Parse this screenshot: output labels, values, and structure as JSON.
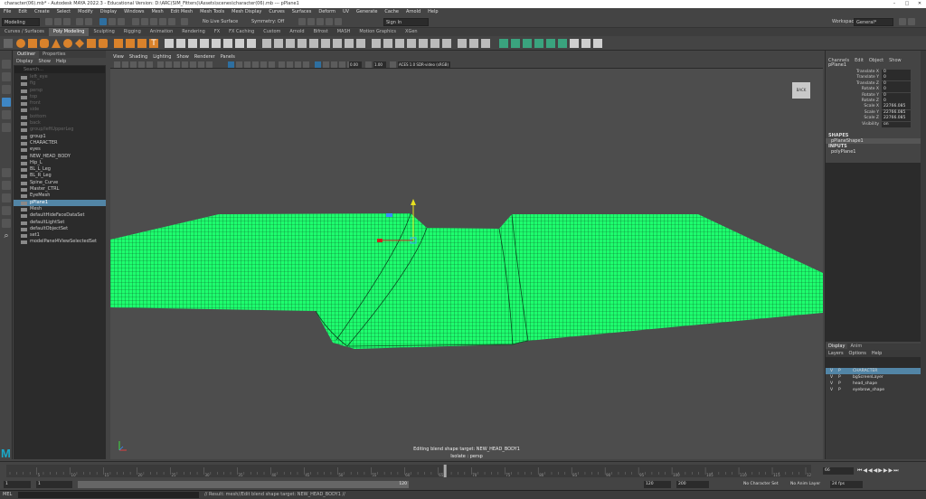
{
  "window": {
    "title": "character(06).mb* - Autodesk MAYA 2022.3 - Educational Version: D:\\ARC(SIM_Fitters)\\Assets\\scenes\\character(06).mb --- pPlane1"
  },
  "menubar": [
    "File",
    "Edit",
    "Create",
    "Select",
    "Modify",
    "Display",
    "Windows",
    "Mesh",
    "Edit Mesh",
    "Mesh Tools",
    "Mesh Display",
    "Curves",
    "Surfaces",
    "Deform",
    "UV",
    "Generate",
    "Cache",
    "Arnold",
    "Help"
  ],
  "status": {
    "mode": "Modeling",
    "live_surface": "No Live Surface",
    "symmetry": "Symmetry: Off",
    "sign_in": "Sign In",
    "workspace_label": "Workspace:",
    "workspace": "General*"
  },
  "shelf_tabs": [
    "Curves / Surfaces",
    "Poly Modeling",
    "Sculpting",
    "Rigging",
    "Animation",
    "Rendering",
    "FX",
    "FX Caching",
    "Custom",
    "Arnold",
    "Bifrost",
    "MASH",
    "Motion Graphics",
    "XGen"
  ],
  "shelf_active": "Poly Modeling",
  "outliner": {
    "tabs": [
      "Outliner",
      "Properties"
    ],
    "menu": [
      "Display",
      "Show",
      "Help"
    ],
    "search": "Search...",
    "items": [
      {
        "label": "left_eye",
        "dim": true
      },
      {
        "label": "fig",
        "dim": true
      },
      {
        "label": "persp",
        "dim": true
      },
      {
        "label": "top",
        "dim": true
      },
      {
        "label": "front",
        "dim": true
      },
      {
        "label": "side",
        "dim": true
      },
      {
        "label": "bottom",
        "dim": true
      },
      {
        "label": "back",
        "dim": true
      },
      {
        "label": "group/leftUpperLeg",
        "dim": true
      },
      {
        "label": "group1",
        "dim": false
      },
      {
        "label": "CHARACTER",
        "dim": false
      },
      {
        "label": "eyes",
        "dim": false
      },
      {
        "label": "NEW_HEAD_BODY",
        "dim": false
      },
      {
        "label": "Hip_L",
        "dim": false
      },
      {
        "label": "BL_L_Leg",
        "dim": false
      },
      {
        "label": "BL_R_Leg",
        "dim": false
      },
      {
        "label": "Spine_Curve",
        "dim": false
      },
      {
        "label": "Master_CTRL",
        "dim": false
      },
      {
        "label": "EyeMesh",
        "dim": false
      },
      {
        "label": "pPlane1",
        "dim": false,
        "selected": true
      },
      {
        "label": "Mesh",
        "dim": false
      },
      {
        "label": "defaultHideFaceDataSet",
        "dim": false
      },
      {
        "label": "defaultLightSet",
        "dim": false
      },
      {
        "label": "defaultObjectSet",
        "dim": false
      },
      {
        "label": "set1",
        "dim": false
      },
      {
        "label": "modelPanel4ViewSelectedSet",
        "dim": false
      }
    ]
  },
  "viewport": {
    "menu": [
      "View",
      "Shading",
      "Lighting",
      "Show",
      "Renderer",
      "Panels"
    ],
    "field1": "0.00",
    "field2": "1.00",
    "color_space": "ACES 1.0 SDR-video (sRGB)",
    "viewcube": "BACK",
    "caption1": "Editing blend shape target: NEW_HEAD_BODY1",
    "caption2": "Isolate : persp",
    "mesh_color": "#1eff6e"
  },
  "channelbox": {
    "menu": [
      "Channels",
      "Edit",
      "Object",
      "Show"
    ],
    "object": "pPlane1",
    "channels": [
      {
        "label": "Translate X",
        "value": "0"
      },
      {
        "label": "Translate Y",
        "value": "0"
      },
      {
        "label": "Translate Z",
        "value": "0"
      },
      {
        "label": "Rotate X",
        "value": "0"
      },
      {
        "label": "Rotate Y",
        "value": "0"
      },
      {
        "label": "Rotate Z",
        "value": "0"
      },
      {
        "label": "Scale X",
        "value": "22766.085"
      },
      {
        "label": "Scale Y",
        "value": "22766.085"
      },
      {
        "label": "Scale Z",
        "value": "22766.085"
      },
      {
        "label": "Visibility",
        "value": "on"
      }
    ],
    "shapes_label": "SHAPES",
    "shape": "pPlaneShape1",
    "inputs_label": "INPUTS",
    "input": "polyPlane1"
  },
  "layers": {
    "tabs": [
      "Display",
      "Anim"
    ],
    "menu": [
      "Layers",
      "Options",
      "Help"
    ],
    "items": [
      {
        "v": "V",
        "p": "P",
        "name": "CHARACTER",
        "selected": true
      },
      {
        "v": "V",
        "p": "P",
        "name": "bgScreenLayer"
      },
      {
        "v": "V",
        "p": "P",
        "name": "head_shape"
      },
      {
        "v": "V",
        "p": "P",
        "name": "eyebrow_shape"
      }
    ]
  },
  "timeline": {
    "current_frame": "66",
    "tick_labels": [
      "5",
      "10",
      "15",
      "20",
      "25",
      "30",
      "35",
      "40",
      "45",
      "50",
      "55",
      "60",
      "65",
      "70",
      "75",
      "80",
      "85",
      "90",
      "95",
      "100",
      "105",
      "110",
      "115",
      "120"
    ]
  },
  "range": {
    "start": "1",
    "start2": "1",
    "end_inner": "120",
    "end": "120",
    "end2": "200",
    "char_set": "No Character Set",
    "anim_layer": "No Anim Layer",
    "fps": "24 fps"
  },
  "cmd": {
    "lang": "MEL",
    "text": "// Result: mesh//Edit blend shape target: NEW_HEAD_BODY1 //"
  }
}
